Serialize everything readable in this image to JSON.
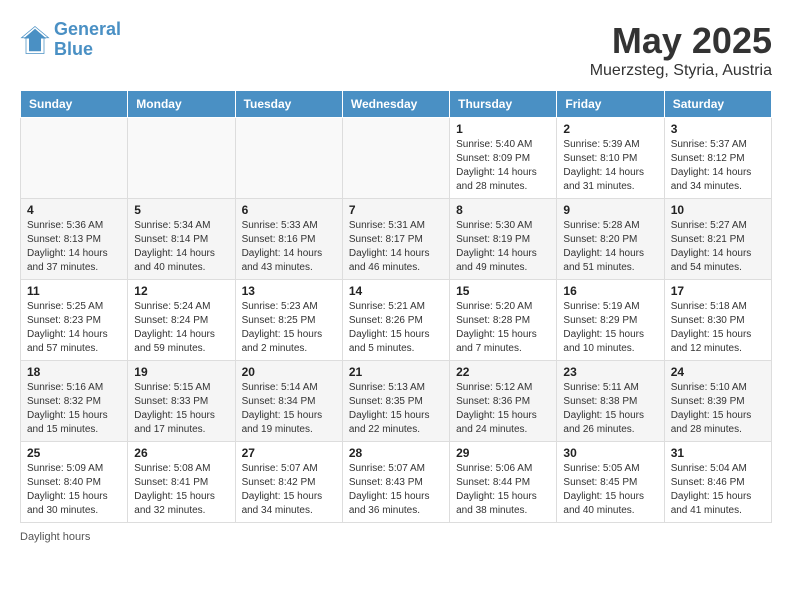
{
  "header": {
    "logo_line1": "General",
    "logo_line2": "Blue",
    "title": "May 2025",
    "subtitle": "Muerzsteg, Styria, Austria"
  },
  "weekdays": [
    "Sunday",
    "Monday",
    "Tuesday",
    "Wednesday",
    "Thursday",
    "Friday",
    "Saturday"
  ],
  "weeks": [
    [
      {
        "day": "",
        "info": ""
      },
      {
        "day": "",
        "info": ""
      },
      {
        "day": "",
        "info": ""
      },
      {
        "day": "",
        "info": ""
      },
      {
        "day": "1",
        "info": "Sunrise: 5:40 AM\nSunset: 8:09 PM\nDaylight: 14 hours\nand 28 minutes."
      },
      {
        "day": "2",
        "info": "Sunrise: 5:39 AM\nSunset: 8:10 PM\nDaylight: 14 hours\nand 31 minutes."
      },
      {
        "day": "3",
        "info": "Sunrise: 5:37 AM\nSunset: 8:12 PM\nDaylight: 14 hours\nand 34 minutes."
      }
    ],
    [
      {
        "day": "4",
        "info": "Sunrise: 5:36 AM\nSunset: 8:13 PM\nDaylight: 14 hours\nand 37 minutes."
      },
      {
        "day": "5",
        "info": "Sunrise: 5:34 AM\nSunset: 8:14 PM\nDaylight: 14 hours\nand 40 minutes."
      },
      {
        "day": "6",
        "info": "Sunrise: 5:33 AM\nSunset: 8:16 PM\nDaylight: 14 hours\nand 43 minutes."
      },
      {
        "day": "7",
        "info": "Sunrise: 5:31 AM\nSunset: 8:17 PM\nDaylight: 14 hours\nand 46 minutes."
      },
      {
        "day": "8",
        "info": "Sunrise: 5:30 AM\nSunset: 8:19 PM\nDaylight: 14 hours\nand 49 minutes."
      },
      {
        "day": "9",
        "info": "Sunrise: 5:28 AM\nSunset: 8:20 PM\nDaylight: 14 hours\nand 51 minutes."
      },
      {
        "day": "10",
        "info": "Sunrise: 5:27 AM\nSunset: 8:21 PM\nDaylight: 14 hours\nand 54 minutes."
      }
    ],
    [
      {
        "day": "11",
        "info": "Sunrise: 5:25 AM\nSunset: 8:23 PM\nDaylight: 14 hours\nand 57 minutes."
      },
      {
        "day": "12",
        "info": "Sunrise: 5:24 AM\nSunset: 8:24 PM\nDaylight: 14 hours\nand 59 minutes."
      },
      {
        "day": "13",
        "info": "Sunrise: 5:23 AM\nSunset: 8:25 PM\nDaylight: 15 hours\nand 2 minutes."
      },
      {
        "day": "14",
        "info": "Sunrise: 5:21 AM\nSunset: 8:26 PM\nDaylight: 15 hours\nand 5 minutes."
      },
      {
        "day": "15",
        "info": "Sunrise: 5:20 AM\nSunset: 8:28 PM\nDaylight: 15 hours\nand 7 minutes."
      },
      {
        "day": "16",
        "info": "Sunrise: 5:19 AM\nSunset: 8:29 PM\nDaylight: 15 hours\nand 10 minutes."
      },
      {
        "day": "17",
        "info": "Sunrise: 5:18 AM\nSunset: 8:30 PM\nDaylight: 15 hours\nand 12 minutes."
      }
    ],
    [
      {
        "day": "18",
        "info": "Sunrise: 5:16 AM\nSunset: 8:32 PM\nDaylight: 15 hours\nand 15 minutes."
      },
      {
        "day": "19",
        "info": "Sunrise: 5:15 AM\nSunset: 8:33 PM\nDaylight: 15 hours\nand 17 minutes."
      },
      {
        "day": "20",
        "info": "Sunrise: 5:14 AM\nSunset: 8:34 PM\nDaylight: 15 hours\nand 19 minutes."
      },
      {
        "day": "21",
        "info": "Sunrise: 5:13 AM\nSunset: 8:35 PM\nDaylight: 15 hours\nand 22 minutes."
      },
      {
        "day": "22",
        "info": "Sunrise: 5:12 AM\nSunset: 8:36 PM\nDaylight: 15 hours\nand 24 minutes."
      },
      {
        "day": "23",
        "info": "Sunrise: 5:11 AM\nSunset: 8:38 PM\nDaylight: 15 hours\nand 26 minutes."
      },
      {
        "day": "24",
        "info": "Sunrise: 5:10 AM\nSunset: 8:39 PM\nDaylight: 15 hours\nand 28 minutes."
      }
    ],
    [
      {
        "day": "25",
        "info": "Sunrise: 5:09 AM\nSunset: 8:40 PM\nDaylight: 15 hours\nand 30 minutes."
      },
      {
        "day": "26",
        "info": "Sunrise: 5:08 AM\nSunset: 8:41 PM\nDaylight: 15 hours\nand 32 minutes."
      },
      {
        "day": "27",
        "info": "Sunrise: 5:07 AM\nSunset: 8:42 PM\nDaylight: 15 hours\nand 34 minutes."
      },
      {
        "day": "28",
        "info": "Sunrise: 5:07 AM\nSunset: 8:43 PM\nDaylight: 15 hours\nand 36 minutes."
      },
      {
        "day": "29",
        "info": "Sunrise: 5:06 AM\nSunset: 8:44 PM\nDaylight: 15 hours\nand 38 minutes."
      },
      {
        "day": "30",
        "info": "Sunrise: 5:05 AM\nSunset: 8:45 PM\nDaylight: 15 hours\nand 40 minutes."
      },
      {
        "day": "31",
        "info": "Sunrise: 5:04 AM\nSunset: 8:46 PM\nDaylight: 15 hours\nand 41 minutes."
      }
    ]
  ],
  "footer": {
    "note": "Daylight hours"
  }
}
